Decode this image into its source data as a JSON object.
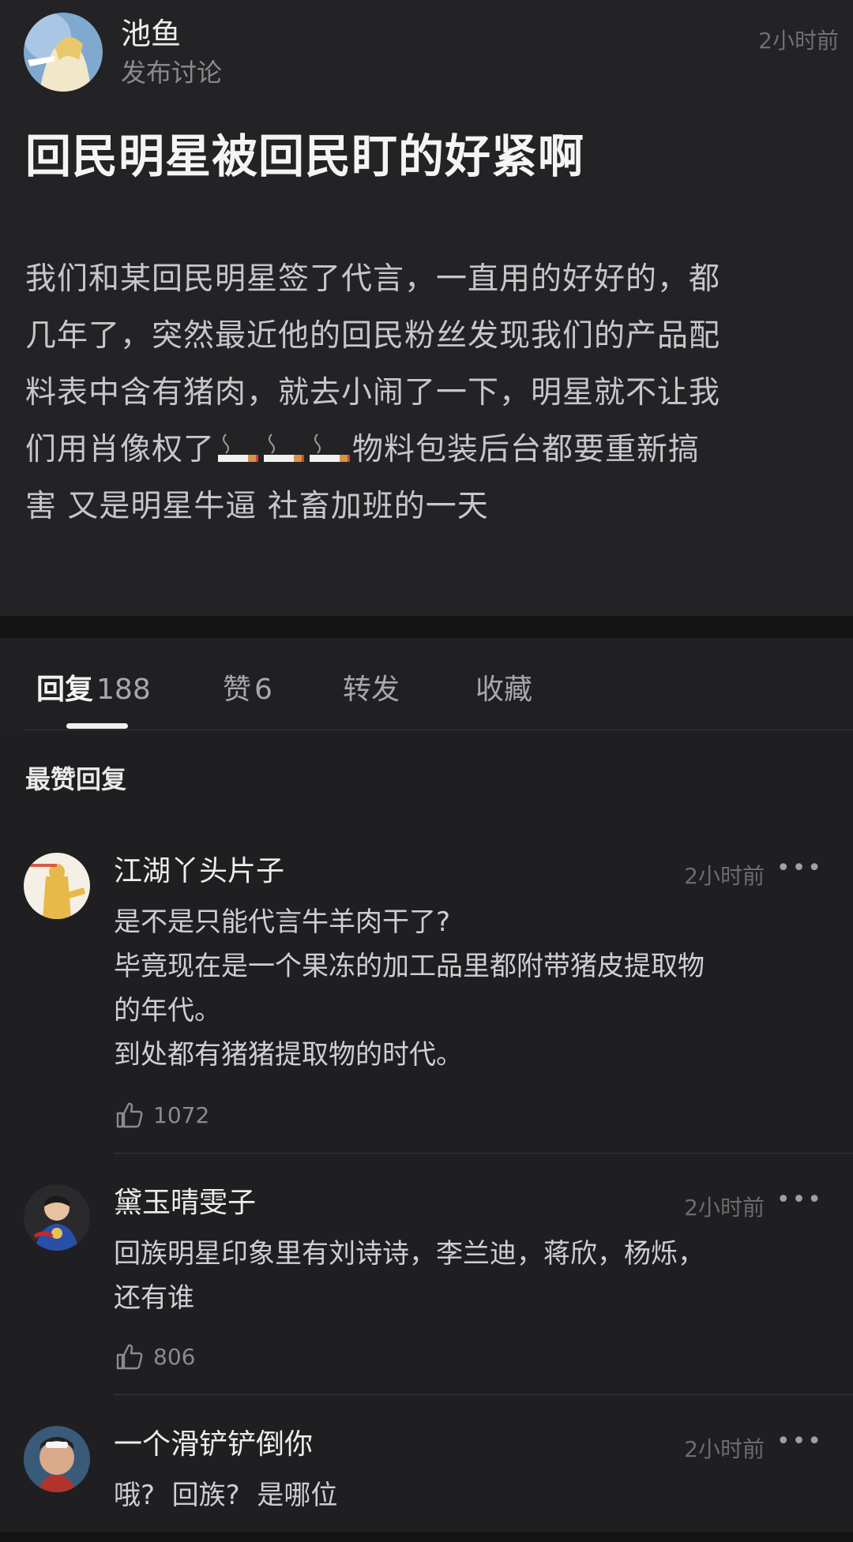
{
  "post": {
    "author": "池鱼",
    "subtitle": "发布讨论",
    "time": "2小时前",
    "title": "回民明星被回民盯的好紧啊",
    "body_lines": [
      "我们和某回民明星签了代言，一直用的好好的，都",
      "几年了，突然最近他的回民粉丝发现我们的产品配",
      "料表中含有猪肉，就去小闹了一下，明星就不让我",
      "们用肖像权了",
      "物料包装后台都要重新搞",
      "害 又是明星牛逼 社畜加班的一天"
    ],
    "emoji": [
      "cigarette-emoji",
      "cigarette-emoji",
      "cigarette-emoji"
    ]
  },
  "tabs": [
    {
      "label": "回复",
      "count": "188"
    },
    {
      "label": "赞",
      "count": "6"
    },
    {
      "label": "转发",
      "count": ""
    },
    {
      "label": "收藏",
      "count": ""
    }
  ],
  "section_title": "最赞回复",
  "comments": [
    {
      "name": "江湖丫头片子",
      "time": "2小时前",
      "more": "•••",
      "lines": [
        "是不是只能代言牛羊肉干了?",
        "毕竟现在是一个果冻的加工品里都附带猪皮提取物",
        "的年代。",
        "到处都有猪猪提取物的时代。"
      ],
      "likes": "1072"
    },
    {
      "name": "黛玉晴雯子",
      "time": "2小时前",
      "more": "•••",
      "lines": [
        "回族明星印象里有刘诗诗，李兰迪，蒋欣，杨烁，",
        "还有谁"
      ],
      "likes": "806"
    },
    {
      "name": "一个滑铲铲倒你",
      "time": "2小时前",
      "more": "•••",
      "lines": [
        "哦?  回族?  是哪位"
      ]
    }
  ],
  "colors": {
    "background": "#1f1f21",
    "text_primary": "#ececec",
    "text_secondary": "#8a8a8c"
  }
}
